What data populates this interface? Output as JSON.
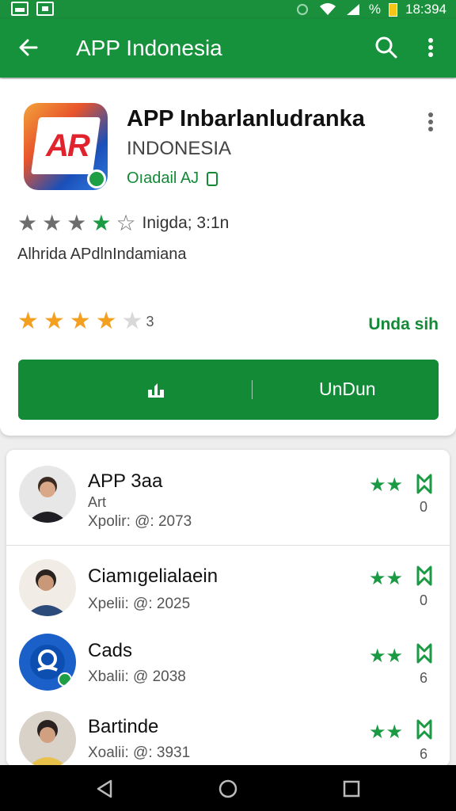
{
  "status": {
    "time": "18:394",
    "battery_label": "%"
  },
  "appbar": {
    "title": "APP Indonesia"
  },
  "app": {
    "name": "APP Inbarlanludranka",
    "subtitle": "INDONESIA",
    "developer": "Oıadail AJ",
    "logo_text": "AR",
    "rating_text": "Inigda; 3:1n",
    "description": "Alhrida APdlnIndamiana",
    "rating_count": "3",
    "side_link": "Unda sih",
    "download_label": "UnDun"
  },
  "list": [
    {
      "name": "APP 3aa",
      "sub": "Art",
      "meta": "Xpolir: @: 2073",
      "count": "0"
    },
    {
      "name": "Ciamıgelialaein",
      "sub": "",
      "meta": "Xpelii: @: 2025",
      "count": "0"
    },
    {
      "name": "Cads",
      "sub": "",
      "meta": "Xbalii: @ 2038",
      "count": "6"
    },
    {
      "name": "Bartinde",
      "sub": "",
      "meta": "Xoalii: @: 3931",
      "count": "6"
    }
  ],
  "icons": {
    "back": "arrow-left-icon",
    "search": "search-icon",
    "more": "more-vert-icon",
    "bookmark": "bookmark-icon",
    "nav_back": "triangle-back-icon",
    "nav_home": "circle-home-icon",
    "nav_recent": "square-recent-icon"
  },
  "colors": {
    "primary": "#17923c",
    "accent_star": "#f3a021"
  }
}
